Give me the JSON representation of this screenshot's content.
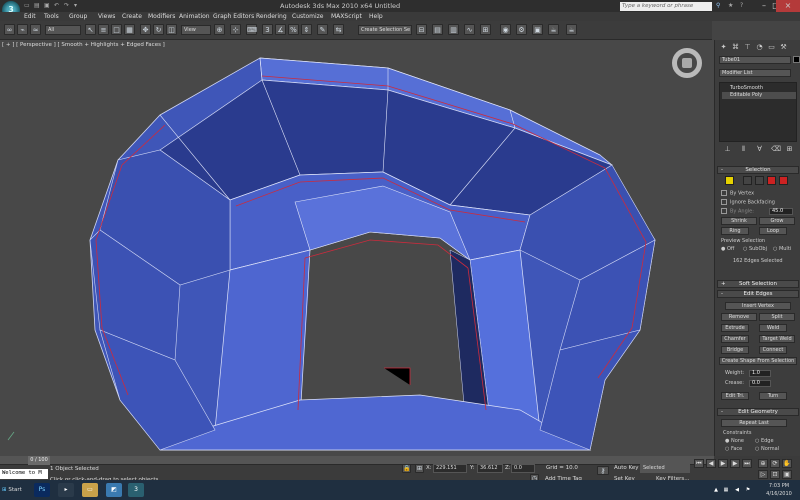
{
  "titlebar": {
    "title": "Autodesk 3ds Max 2010 x64      Untitled",
    "search_placeholder": "Type a keyword or phrase",
    "logo_letter": "3"
  },
  "menu": [
    "Edit",
    "Tools",
    "Group",
    "Views",
    "Create",
    "Modifiers",
    "Animation",
    "Graph Editors",
    "Rendering",
    "Customize",
    "MAXScript",
    "Help"
  ],
  "toolbar": {
    "selection_filter": "All",
    "ref_coord": "View",
    "named_selection": "Create Selection Se"
  },
  "viewport": {
    "label": "[ + ] [ Perspective ] [ Smooth + Highlights + Edged Faces ]"
  },
  "command_panel": {
    "object_name": "Tube01",
    "modifier_list": "Modifier List",
    "stack": [
      "TurboSmooth",
      "Editable Poly"
    ],
    "selection": {
      "title": "Selection",
      "by_vertex": "By Vertex",
      "ignore_backfacing": "Ignore Backfacing",
      "by_angle": "By Angle:",
      "by_angle_value": "45.0",
      "shrink": "Shrink",
      "grow": "Grow",
      "ring": "Ring",
      "loop": "Loop",
      "preview_selection": "Preview Selection",
      "preview_off": "Off",
      "preview_subobj": "SubObj",
      "preview_multi": "Multi",
      "status": "162 Edges Selected"
    },
    "soft_selection": "Soft Selection",
    "edit_edges": {
      "title": "Edit Edges",
      "insert_vertex": "Insert Vertex",
      "remove": "Remove",
      "split": "Split",
      "extrude": "Extrude",
      "weld": "Weld",
      "chamfer": "Chamfer",
      "target_weld": "Target Weld",
      "bridge": "Bridge",
      "connect": "Connect",
      "create_shape": "Create Shape From Selection",
      "weight_label": "Weight:",
      "weight_value": "1.0",
      "crease_label": "Crease:",
      "crease_value": "0.0",
      "edit_tri": "Edit Tri.",
      "turn": "Turn"
    },
    "edit_geometry": {
      "title": "Edit Geometry",
      "repeat_last": "Repeat Last",
      "constraints": "Constraints",
      "none": "None",
      "edge": "Edge",
      "face": "Face",
      "normal": "Normal"
    }
  },
  "status": {
    "frame": "0 / 100",
    "selected": "1 Object Selected",
    "prompt": "Click or click-and-drag to select objects",
    "x_label": "X:",
    "x_value": "229.151",
    "y_label": "Y:",
    "y_value": "36.612",
    "z_label": "Z:",
    "z_value": "0.0",
    "grid": "Grid = 10.0",
    "add_time_tag": "Add Time Tag",
    "auto_key": "Auto Key",
    "set_key": "Set Key",
    "selected_dropdown": "Selected",
    "key_filters": "Key Filters...",
    "listener": "Welcome to M"
  },
  "taskbar": {
    "start": "Start",
    "time": "7:03 PM",
    "date": "4/16/2010"
  },
  "colors": {
    "mesh": "#4a62c8",
    "mesh_dark": "#1f2d66",
    "edge_selected": "#cc2b3d",
    "viewport_bg": "#484848"
  }
}
